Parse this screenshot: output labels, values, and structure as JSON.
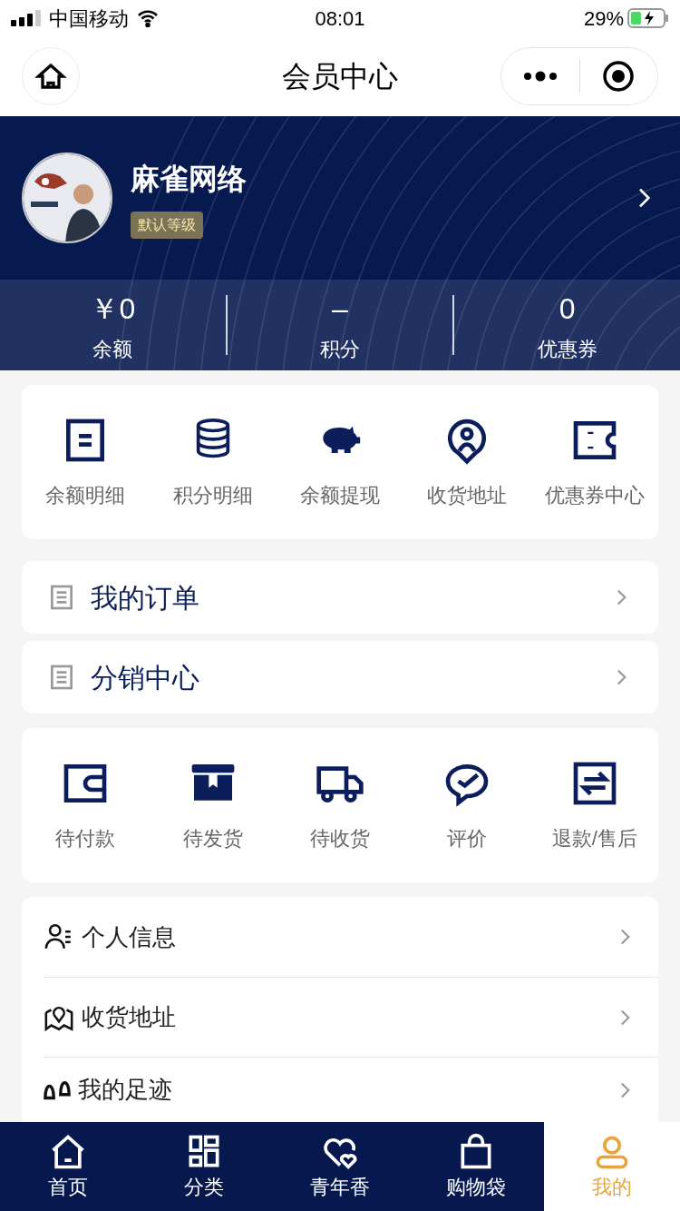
{
  "status_bar": {
    "carrier": "中国移动",
    "time": "08:01",
    "battery": "29%"
  },
  "nav": {
    "title": "会员中心"
  },
  "profile": {
    "name": "麻雀网络",
    "level_badge": "默认等级"
  },
  "stats": [
    {
      "value": "￥0",
      "label": "余额"
    },
    {
      "value": "–",
      "label": "积分"
    },
    {
      "value": "0",
      "label": "优惠券"
    }
  ],
  "quick_actions": [
    {
      "kind": "document",
      "label": "余额明细"
    },
    {
      "kind": "coins",
      "label": "积分明细"
    },
    {
      "kind": "piggy",
      "label": "余额提现"
    },
    {
      "kind": "pin",
      "label": "收货地址"
    },
    {
      "kind": "ticket",
      "label": "优惠券中心"
    }
  ],
  "menu_cards": [
    {
      "label": "我的订单"
    },
    {
      "label": "分销中心"
    }
  ],
  "order_status": [
    {
      "kind": "wallet",
      "label": "待付款"
    },
    {
      "kind": "box",
      "label": "待发货"
    },
    {
      "kind": "truck",
      "label": "待收货"
    },
    {
      "kind": "chat",
      "label": "评价"
    },
    {
      "kind": "exchange",
      "label": "退款/售后"
    }
  ],
  "settings_list": [
    {
      "kind": "person",
      "label": "个人信息"
    },
    {
      "kind": "map",
      "label": "收货地址"
    },
    {
      "kind": "footprint",
      "label": "我的足迹"
    }
  ],
  "tab_bar": [
    {
      "kind": "home",
      "label": "首页",
      "selected": false
    },
    {
      "kind": "grid",
      "label": "分类",
      "selected": false
    },
    {
      "kind": "heart",
      "label": "青年香",
      "selected": false
    },
    {
      "kind": "bag",
      "label": "购物袋",
      "selected": false
    },
    {
      "kind": "user",
      "label": "我的",
      "selected": true
    }
  ]
}
